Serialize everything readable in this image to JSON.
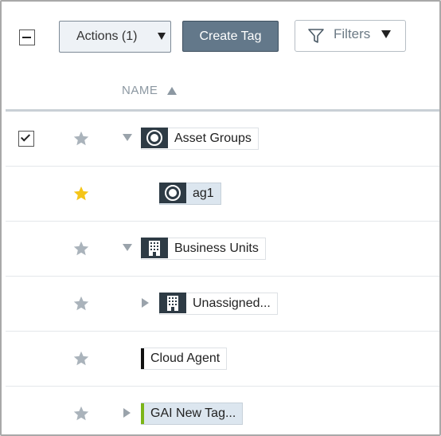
{
  "toolbar": {
    "actions_label": "Actions (1)",
    "create_label": "Create Tag",
    "filters_label": "Filters"
  },
  "table": {
    "column_name": "NAME",
    "sort": "ascending"
  },
  "rows": [
    {
      "label": "Asset Groups",
      "icon": "asset-group-icon",
      "checked": true,
      "starred": false,
      "expander": "expanded",
      "level": 0
    },
    {
      "label": "ag1",
      "icon": "asset-group-icon",
      "checked": false,
      "starred": true,
      "expander": "none",
      "level": 1
    },
    {
      "label": "Business Units",
      "icon": "building-icon",
      "checked": false,
      "starred": false,
      "expander": "expanded",
      "level": 0
    },
    {
      "label": "Unassigned...",
      "icon": "building-icon",
      "checked": false,
      "starred": false,
      "expander": "collapsed",
      "level": 1
    },
    {
      "label": "Cloud Agent",
      "icon": "color-bar",
      "bar_color": "#111111",
      "checked": false,
      "starred": false,
      "expander": "none",
      "level": 0
    },
    {
      "label": "GAI New Tag...",
      "icon": "color-bar",
      "bar_color": "#7cb518",
      "checked": false,
      "starred": false,
      "expander": "collapsed",
      "level": 0
    }
  ],
  "colors": {
    "star_active": "#f5c518",
    "star_inactive": "#aab3bb",
    "primary_button": "#63788a",
    "tag_icon_bg": "#2e3b45"
  }
}
